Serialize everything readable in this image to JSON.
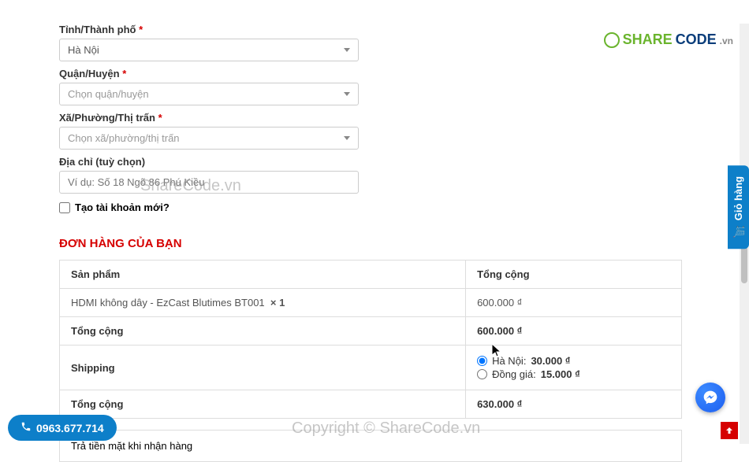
{
  "logo": {
    "share": "SHARE",
    "code": "CODE",
    "vn": ".vn"
  },
  "form": {
    "province": {
      "label": "Tỉnh/Thành phố",
      "value": "Hà Nội"
    },
    "district": {
      "label": "Quận/Huyện",
      "placeholder": "Chọn quận/huyện"
    },
    "ward": {
      "label": "Xã/Phường/Thị trấn",
      "placeholder": "Chọn xã/phường/thị trấn"
    },
    "address": {
      "label": "Địa chỉ (tuỳ chọn)",
      "placeholder": "Ví dụ: Số 18 Ngõ 86 Phú Kiều"
    },
    "create_account": "Tạo tài khoản mới?"
  },
  "order": {
    "section_title": "ĐƠN HÀNG CỦA BẠN",
    "headers": {
      "product": "Sản phẩm",
      "total": "Tổng cộng"
    },
    "item": {
      "name": "HDMI không dây - EzCast Blutimes BT001",
      "qty": "× 1",
      "price": "600.000 ₫"
    },
    "subtotal": {
      "label": "Tổng cộng",
      "value": "600.000 ₫"
    },
    "shipping": {
      "label": "Shipping",
      "opt1": {
        "text": "Hà Nội:",
        "price": "30.000 ₫"
      },
      "opt2": {
        "text": "Đồng giá:",
        "price": "15.000 ₫"
      }
    },
    "total": {
      "label": "Tổng cộng",
      "value": "630.000 ₫"
    }
  },
  "payment": {
    "cod": "Trả tiền mặt khi nhận hàng"
  },
  "side_tab": "Giỏ hàng",
  "phone": "0963.677.714",
  "watermark": {
    "text1": "ShareCode.vn",
    "text2": "Copyright © ShareCode.vn"
  }
}
